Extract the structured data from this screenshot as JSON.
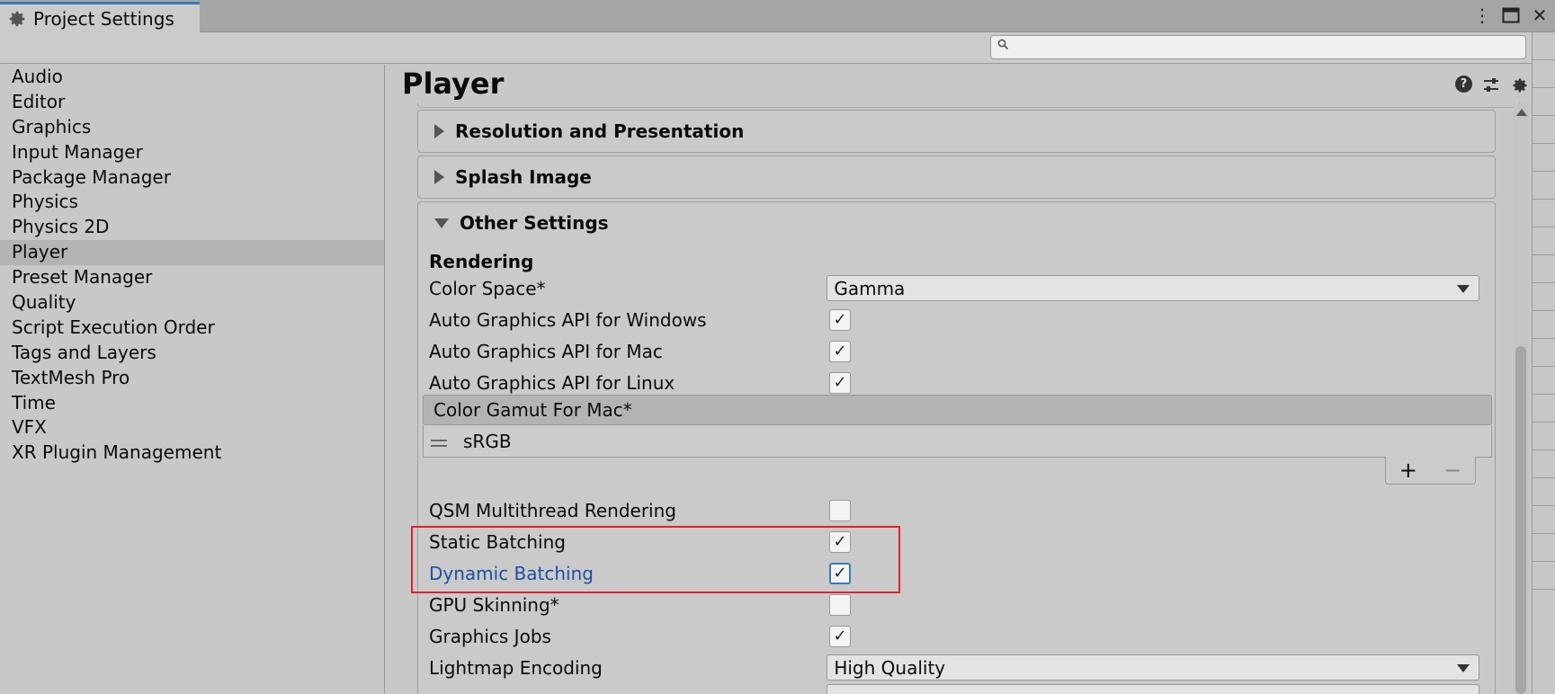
{
  "window": {
    "tab_title": "Project Settings",
    "menu_icon": "kebab-menu-icon",
    "maximize_icon": "maximize-icon",
    "close_icon": "close-icon"
  },
  "search": {
    "placeholder": "",
    "value": ""
  },
  "sidebar": {
    "items": [
      {
        "label": "Audio"
      },
      {
        "label": "Editor"
      },
      {
        "label": "Graphics"
      },
      {
        "label": "Input Manager"
      },
      {
        "label": "Package Manager"
      },
      {
        "label": "Physics"
      },
      {
        "label": "Physics 2D"
      },
      {
        "label": "Player",
        "active": true
      },
      {
        "label": "Preset Manager"
      },
      {
        "label": "Quality"
      },
      {
        "label": "Script Execution Order"
      },
      {
        "label": "Tags and Layers"
      },
      {
        "label": "TextMesh Pro"
      },
      {
        "label": "Time"
      },
      {
        "label": "VFX"
      },
      {
        "label": "XR Plugin Management"
      }
    ]
  },
  "main": {
    "title": "Player",
    "foldouts": {
      "resolution": "Resolution and Presentation",
      "splash": "Splash Image",
      "other": "Other Settings"
    },
    "section": "Rendering",
    "color_space": {
      "label": "Color Space*",
      "value": "Gamma"
    },
    "auto_win": {
      "label": "Auto Graphics API  for Windows",
      "checked": true
    },
    "auto_mac": {
      "label": "Auto Graphics API  for Mac",
      "checked": true
    },
    "auto_linux": {
      "label": "Auto Graphics API  for Linux",
      "checked": true
    },
    "gamut": {
      "header": "Color Gamut For Mac*",
      "item": "sRGB",
      "add": "+",
      "remove": "−"
    },
    "qsm": {
      "label": "QSM Multithread Rendering",
      "checked": false
    },
    "static_batching": {
      "label": "Static Batching",
      "checked": true
    },
    "dynamic_batching": {
      "label": "Dynamic Batching",
      "checked": true
    },
    "gpu_skinning": {
      "label": "GPU Skinning*",
      "checked": false
    },
    "graphics_jobs": {
      "label": "Graphics Jobs",
      "checked": true
    },
    "lightmap": {
      "label": "Lightmap Encoding",
      "value": "High Quality"
    },
    "checkmark": "✓"
  },
  "colors": {
    "accent": "#3a79bb",
    "highlight_box": "#e0212d",
    "link_label": "#1f4fa3"
  }
}
